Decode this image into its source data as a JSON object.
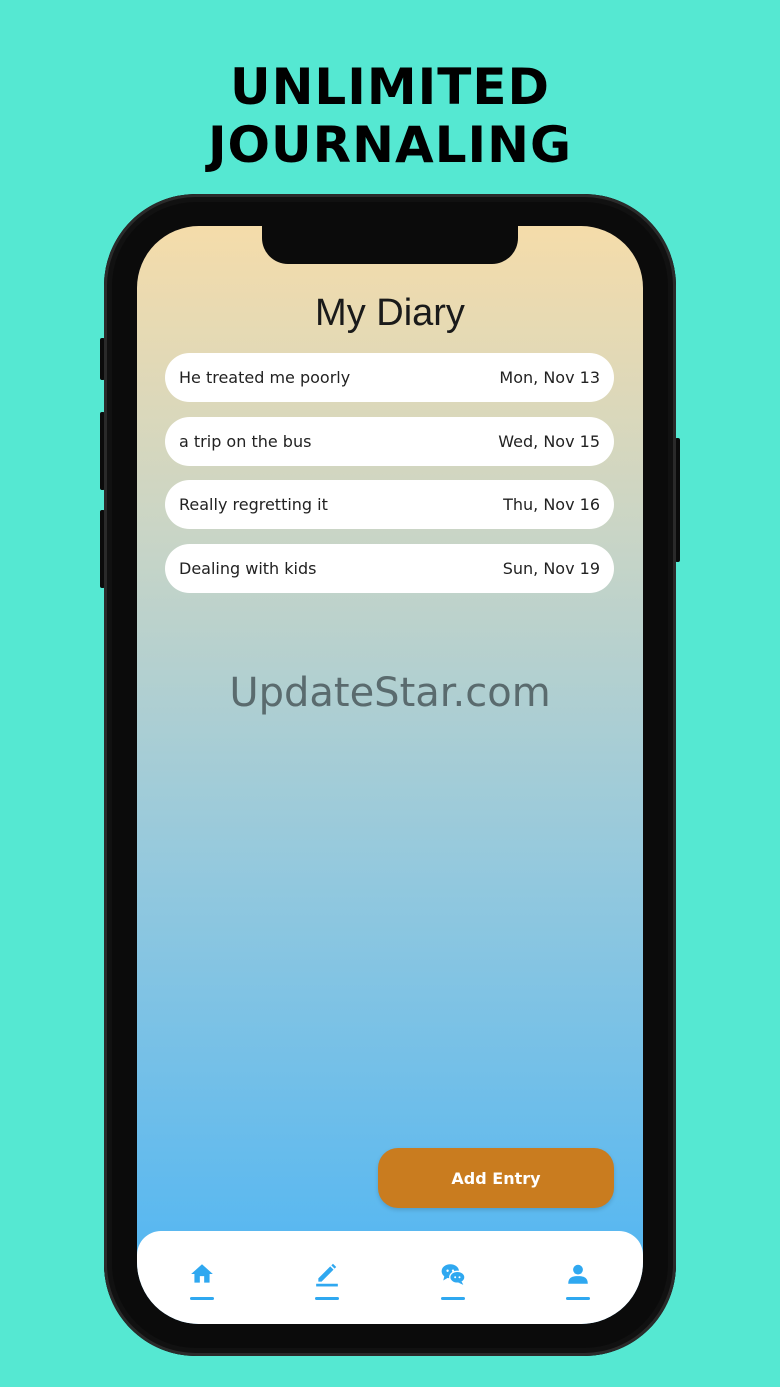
{
  "headline": {
    "line1": "UNLIMITED",
    "line2": "JOURNALING"
  },
  "screen": {
    "title": "My Diary",
    "entries": [
      {
        "title": "He treated me poorly",
        "date": "Mon, Nov 13"
      },
      {
        "title": "a trip on the bus",
        "date": "Wed, Nov 15"
      },
      {
        "title": "Really regretting it",
        "date": "Thu, Nov 16"
      },
      {
        "title": "Dealing with kids",
        "date": "Sun, Nov 19"
      }
    ],
    "watermark": "UpdateStar.com",
    "add_button_label": "Add Entry"
  },
  "navbar": {
    "items": [
      {
        "icon": "home-icon"
      },
      {
        "icon": "pencil-icon"
      },
      {
        "icon": "chat-icon"
      },
      {
        "icon": "profile-icon"
      }
    ]
  },
  "colors": {
    "background": "#55e8d2",
    "accent": "#2fa8f0",
    "add_button": "#c97c1f",
    "gradient_top": "#f5dcaa",
    "gradient_bottom": "#4bb4f5"
  }
}
